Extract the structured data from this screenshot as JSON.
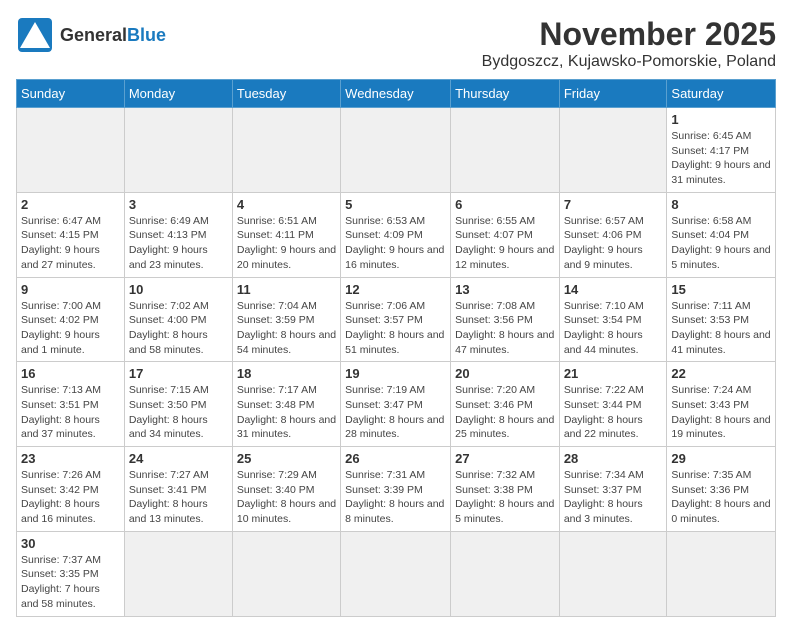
{
  "header": {
    "logo_general": "General",
    "logo_blue": "Blue",
    "month": "November 2025",
    "location": "Bydgoszcz, Kujawsko-Pomorskie, Poland"
  },
  "days_of_week": [
    "Sunday",
    "Monday",
    "Tuesday",
    "Wednesday",
    "Thursday",
    "Friday",
    "Saturday"
  ],
  "weeks": [
    {
      "days": [
        {
          "num": "",
          "info": ""
        },
        {
          "num": "",
          "info": ""
        },
        {
          "num": "",
          "info": ""
        },
        {
          "num": "",
          "info": ""
        },
        {
          "num": "",
          "info": ""
        },
        {
          "num": "",
          "info": ""
        },
        {
          "num": "1",
          "info": "Sunrise: 6:45 AM\nSunset: 4:17 PM\nDaylight: 9 hours and 31 minutes."
        }
      ]
    },
    {
      "days": [
        {
          "num": "2",
          "info": "Sunrise: 6:47 AM\nSunset: 4:15 PM\nDaylight: 9 hours and 27 minutes."
        },
        {
          "num": "3",
          "info": "Sunrise: 6:49 AM\nSunset: 4:13 PM\nDaylight: 9 hours and 23 minutes."
        },
        {
          "num": "4",
          "info": "Sunrise: 6:51 AM\nSunset: 4:11 PM\nDaylight: 9 hours and 20 minutes."
        },
        {
          "num": "5",
          "info": "Sunrise: 6:53 AM\nSunset: 4:09 PM\nDaylight: 9 hours and 16 minutes."
        },
        {
          "num": "6",
          "info": "Sunrise: 6:55 AM\nSunset: 4:07 PM\nDaylight: 9 hours and 12 minutes."
        },
        {
          "num": "7",
          "info": "Sunrise: 6:57 AM\nSunset: 4:06 PM\nDaylight: 9 hours and 9 minutes."
        },
        {
          "num": "8",
          "info": "Sunrise: 6:58 AM\nSunset: 4:04 PM\nDaylight: 9 hours and 5 minutes."
        }
      ]
    },
    {
      "days": [
        {
          "num": "9",
          "info": "Sunrise: 7:00 AM\nSunset: 4:02 PM\nDaylight: 9 hours and 1 minute."
        },
        {
          "num": "10",
          "info": "Sunrise: 7:02 AM\nSunset: 4:00 PM\nDaylight: 8 hours and 58 minutes."
        },
        {
          "num": "11",
          "info": "Sunrise: 7:04 AM\nSunset: 3:59 PM\nDaylight: 8 hours and 54 minutes."
        },
        {
          "num": "12",
          "info": "Sunrise: 7:06 AM\nSunset: 3:57 PM\nDaylight: 8 hours and 51 minutes."
        },
        {
          "num": "13",
          "info": "Sunrise: 7:08 AM\nSunset: 3:56 PM\nDaylight: 8 hours and 47 minutes."
        },
        {
          "num": "14",
          "info": "Sunrise: 7:10 AM\nSunset: 3:54 PM\nDaylight: 8 hours and 44 minutes."
        },
        {
          "num": "15",
          "info": "Sunrise: 7:11 AM\nSunset: 3:53 PM\nDaylight: 8 hours and 41 minutes."
        }
      ]
    },
    {
      "days": [
        {
          "num": "16",
          "info": "Sunrise: 7:13 AM\nSunset: 3:51 PM\nDaylight: 8 hours and 37 minutes."
        },
        {
          "num": "17",
          "info": "Sunrise: 7:15 AM\nSunset: 3:50 PM\nDaylight: 8 hours and 34 minutes."
        },
        {
          "num": "18",
          "info": "Sunrise: 7:17 AM\nSunset: 3:48 PM\nDaylight: 8 hours and 31 minutes."
        },
        {
          "num": "19",
          "info": "Sunrise: 7:19 AM\nSunset: 3:47 PM\nDaylight: 8 hours and 28 minutes."
        },
        {
          "num": "20",
          "info": "Sunrise: 7:20 AM\nSunset: 3:46 PM\nDaylight: 8 hours and 25 minutes."
        },
        {
          "num": "21",
          "info": "Sunrise: 7:22 AM\nSunset: 3:44 PM\nDaylight: 8 hours and 22 minutes."
        },
        {
          "num": "22",
          "info": "Sunrise: 7:24 AM\nSunset: 3:43 PM\nDaylight: 8 hours and 19 minutes."
        }
      ]
    },
    {
      "days": [
        {
          "num": "23",
          "info": "Sunrise: 7:26 AM\nSunset: 3:42 PM\nDaylight: 8 hours and 16 minutes."
        },
        {
          "num": "24",
          "info": "Sunrise: 7:27 AM\nSunset: 3:41 PM\nDaylight: 8 hours and 13 minutes."
        },
        {
          "num": "25",
          "info": "Sunrise: 7:29 AM\nSunset: 3:40 PM\nDaylight: 8 hours and 10 minutes."
        },
        {
          "num": "26",
          "info": "Sunrise: 7:31 AM\nSunset: 3:39 PM\nDaylight: 8 hours and 8 minutes."
        },
        {
          "num": "27",
          "info": "Sunrise: 7:32 AM\nSunset: 3:38 PM\nDaylight: 8 hours and 5 minutes."
        },
        {
          "num": "28",
          "info": "Sunrise: 7:34 AM\nSunset: 3:37 PM\nDaylight: 8 hours and 3 minutes."
        },
        {
          "num": "29",
          "info": "Sunrise: 7:35 AM\nSunset: 3:36 PM\nDaylight: 8 hours and 0 minutes."
        }
      ]
    },
    {
      "days": [
        {
          "num": "30",
          "info": "Sunrise: 7:37 AM\nSunset: 3:35 PM\nDaylight: 7 hours and 58 minutes."
        },
        {
          "num": "",
          "info": ""
        },
        {
          "num": "",
          "info": ""
        },
        {
          "num": "",
          "info": ""
        },
        {
          "num": "",
          "info": ""
        },
        {
          "num": "",
          "info": ""
        },
        {
          "num": "",
          "info": ""
        }
      ]
    }
  ]
}
